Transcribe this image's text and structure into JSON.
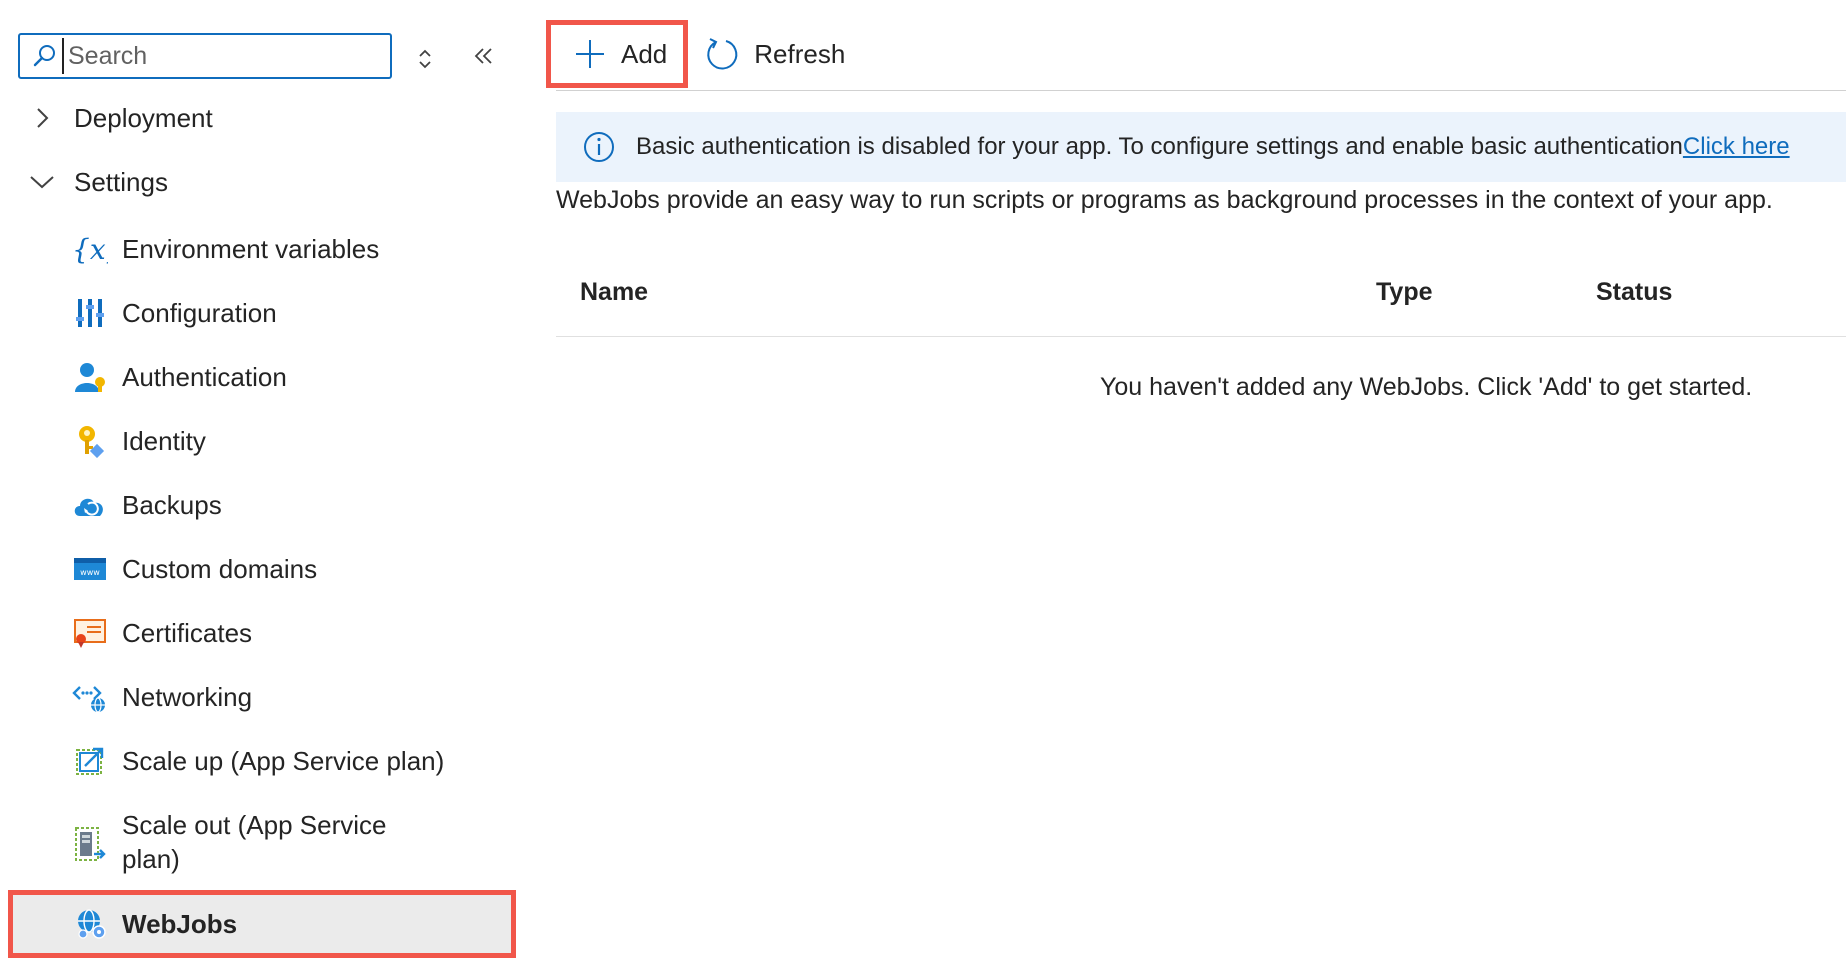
{
  "sidebar": {
    "search": {
      "placeholder": "Search",
      "value": ""
    },
    "groups": [
      {
        "label": "Deployment",
        "expanded": false
      },
      {
        "label": "Settings",
        "expanded": true
      }
    ],
    "items": [
      {
        "label": "Environment variables",
        "icon": "environment-variables-icon"
      },
      {
        "label": "Configuration",
        "icon": "configuration-icon"
      },
      {
        "label": "Authentication",
        "icon": "authentication-icon"
      },
      {
        "label": "Identity",
        "icon": "identity-key-icon"
      },
      {
        "label": "Backups",
        "icon": "backups-cloud-icon"
      },
      {
        "label": "Custom domains",
        "icon": "custom-domains-www-icon"
      },
      {
        "label": "Certificates",
        "icon": "certificates-icon"
      },
      {
        "label": "Networking",
        "icon": "networking-icon"
      },
      {
        "label": "Scale up (App Service plan)",
        "icon": "scale-up-icon"
      },
      {
        "label": "Scale out (App Service plan)",
        "icon": "scale-out-icon"
      },
      {
        "label": "WebJobs",
        "icon": "webjobs-icon",
        "selected": true
      }
    ]
  },
  "toolbar": {
    "add_label": "Add",
    "refresh_label": "Refresh"
  },
  "banner": {
    "text": "Basic authentication is disabled for your app. To configure settings and enable basic authentication",
    "link": "Click here"
  },
  "main": {
    "description": "WebJobs provide an easy way to run scripts or programs as background processes in the context of your app.",
    "columns": [
      "Name",
      "Type",
      "Status"
    ],
    "empty_message": "You haven't added any WebJobs. Click 'Add' to get started."
  },
  "colors": {
    "accent": "#0f6cbd",
    "highlight": "#f1564a",
    "banner_bg": "#ebf3fc",
    "selected_bg": "#ebebeb"
  }
}
